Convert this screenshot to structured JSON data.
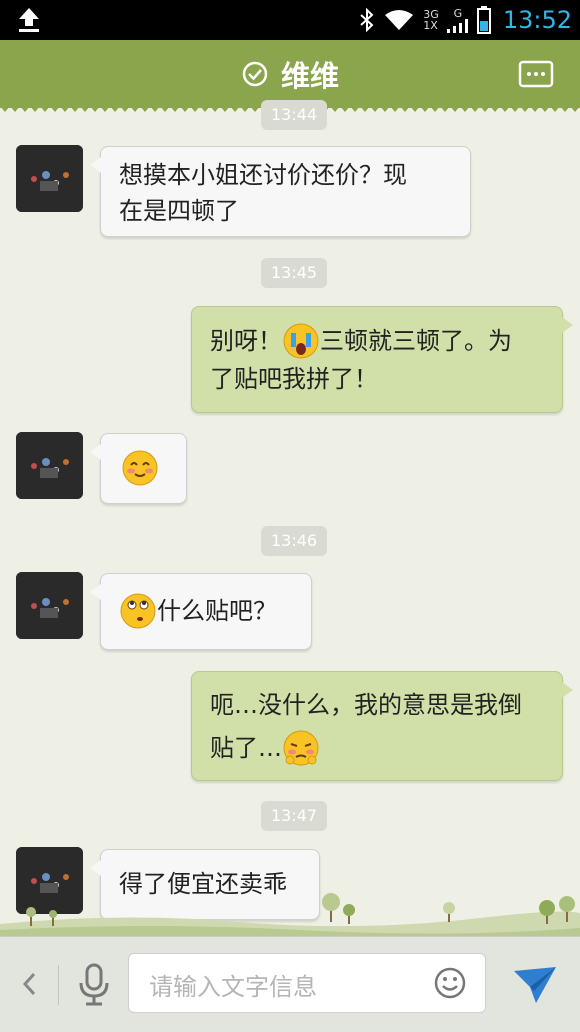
{
  "status_bar": {
    "time": "13:52",
    "net_top": "3G",
    "net_mid": "1X",
    "net_g": "G",
    "icons": [
      "upload-icon",
      "bluetooth-icon",
      "wifi-icon",
      "signal-icon",
      "battery-icon"
    ]
  },
  "header": {
    "title": "维维",
    "status_icon": "check-circle-icon",
    "menu_icon": "chat-menu-icon"
  },
  "messages": [
    {
      "timestamp": "13:44"
    },
    {
      "direction": "in",
      "text_line1": "想摸本小姐还讨价还价？现",
      "text_line2": "在是四顿了"
    },
    {
      "timestamp": "13:45"
    },
    {
      "direction": "out",
      "text_a": "别呀！",
      "emoji": "crying-emoji",
      "text_b": "三顿就三顿了。为",
      "text_line2": "了贴吧我拼了！"
    },
    {
      "direction": "in",
      "emoji": "blushing-smile-emoji"
    },
    {
      "timestamp": "13:46"
    },
    {
      "direction": "in",
      "emoji": "rolling-eyes-emoji",
      "text": "什么贴吧？"
    },
    {
      "direction": "out",
      "text_line1": "呃…没什么，我的意思是我倒",
      "text_line2": "贴了…",
      "emoji": "shy-emoji"
    },
    {
      "timestamp": "13:47"
    },
    {
      "direction": "in",
      "text": "得了便宜还卖乖"
    }
  ],
  "input_bar": {
    "placeholder": "请输入文字信息",
    "icons": [
      "back-arrow-icon",
      "microphone-icon",
      "emoji-icon",
      "send-icon"
    ]
  },
  "colors": {
    "header": "#8aa54b",
    "background": "#eef0e6",
    "incoming_bubble": "#f7f7f7",
    "outgoing_bubble": "#d1e0a8",
    "accent": "#33b5e5"
  }
}
